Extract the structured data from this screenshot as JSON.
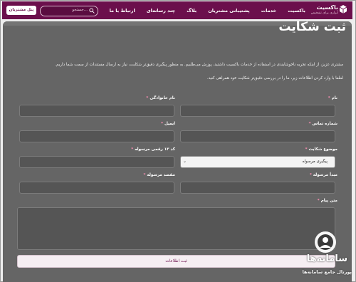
{
  "brand": {
    "name": "باکسیت",
    "tagline": "ابزاری برای تشخیص"
  },
  "nav": {
    "items": [
      "باکسیت",
      "خدمات",
      "پشتیبانی مشتریان",
      "بلاگ",
      "چند رسانه‌ای",
      "ارتباط با ما"
    ]
  },
  "search": {
    "placeholder": "جستجو..."
  },
  "header": {
    "panel_button": "پنل مشتریان"
  },
  "form": {
    "title": "ثبت شکایت",
    "intro_1": "مشتری عزیز، از اینکه تجربه ناخوشایندی در استفاده از خدمات باکسیت داشتید، پوزش می‌طلبیم. به منظور پیگیری دقیق‌تر شکایت، نیاز به ارسال مستندات از سمت شما داریم.",
    "intro_2": "لطفا با وارد کردن اطلاعات زیر، ما را در بررسی دقیق‌تر شکایت خود همراهی کنید.",
    "required_mark": "*",
    "labels": {
      "first_name": "نام",
      "last_name": "نام خانوادگی",
      "phone": "شماره تماس",
      "email": "ایمیل",
      "subject": "موضوع شکایت",
      "tracking_code": "کد ۱۳ رقمی مرسوله",
      "origin": "مبدأ مرسوله",
      "destination": "مقصد مرسوله",
      "message": "متن پیام"
    },
    "subject_selected": "پیگیری مرسوله",
    "submit": "ثبت اطلاعات"
  },
  "watermark": {
    "name": "سامانه‌ها",
    "subtitle": "پورتال جامع سامانه‌ها"
  }
}
